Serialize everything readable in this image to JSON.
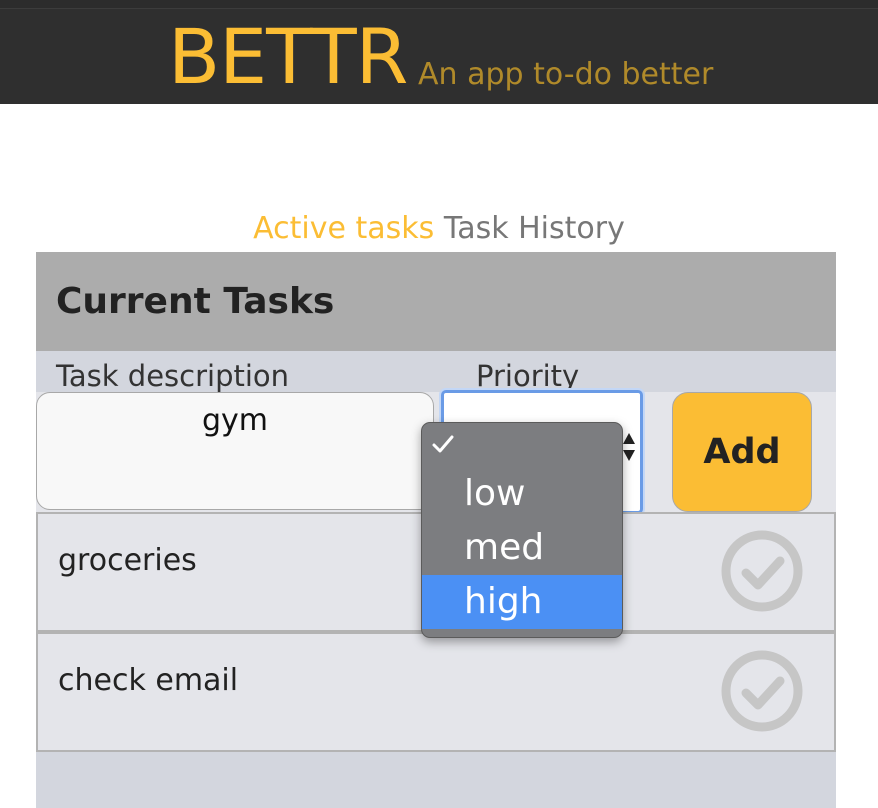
{
  "app": {
    "brand": "BETTR",
    "tagline": "An app to-do better"
  },
  "nav": {
    "active_tab": "Active tasks",
    "history_tab": "Task History"
  },
  "panel": {
    "title": "Current Tasks",
    "desc_label": "Task description",
    "priority_label": "Priority",
    "desc_value": "gym",
    "priority_value": "",
    "add_label": "Add"
  },
  "dropdown": {
    "options": [
      {
        "label": "",
        "checked": true
      },
      {
        "label": "low"
      },
      {
        "label": "med"
      },
      {
        "label": "high",
        "highlighted": true
      }
    ]
  },
  "tasks": [
    {
      "text": "groceries"
    },
    {
      "text": "check email"
    }
  ],
  "colors": {
    "accent": "#fbbd34",
    "header_bg": "#2f2f2f",
    "highlight": "#4b90f4"
  },
  "icons": {
    "complete": "check-circle-icon",
    "selected": "checkmark-icon"
  }
}
